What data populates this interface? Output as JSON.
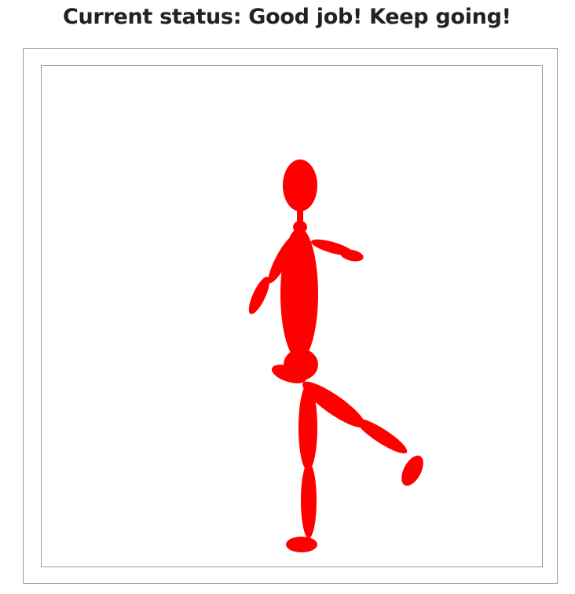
{
  "status": {
    "text": "Current status: Good job! Keep going!"
  },
  "figure": {
    "color": "#ff0000",
    "icon": "stick-figure-balancing"
  }
}
